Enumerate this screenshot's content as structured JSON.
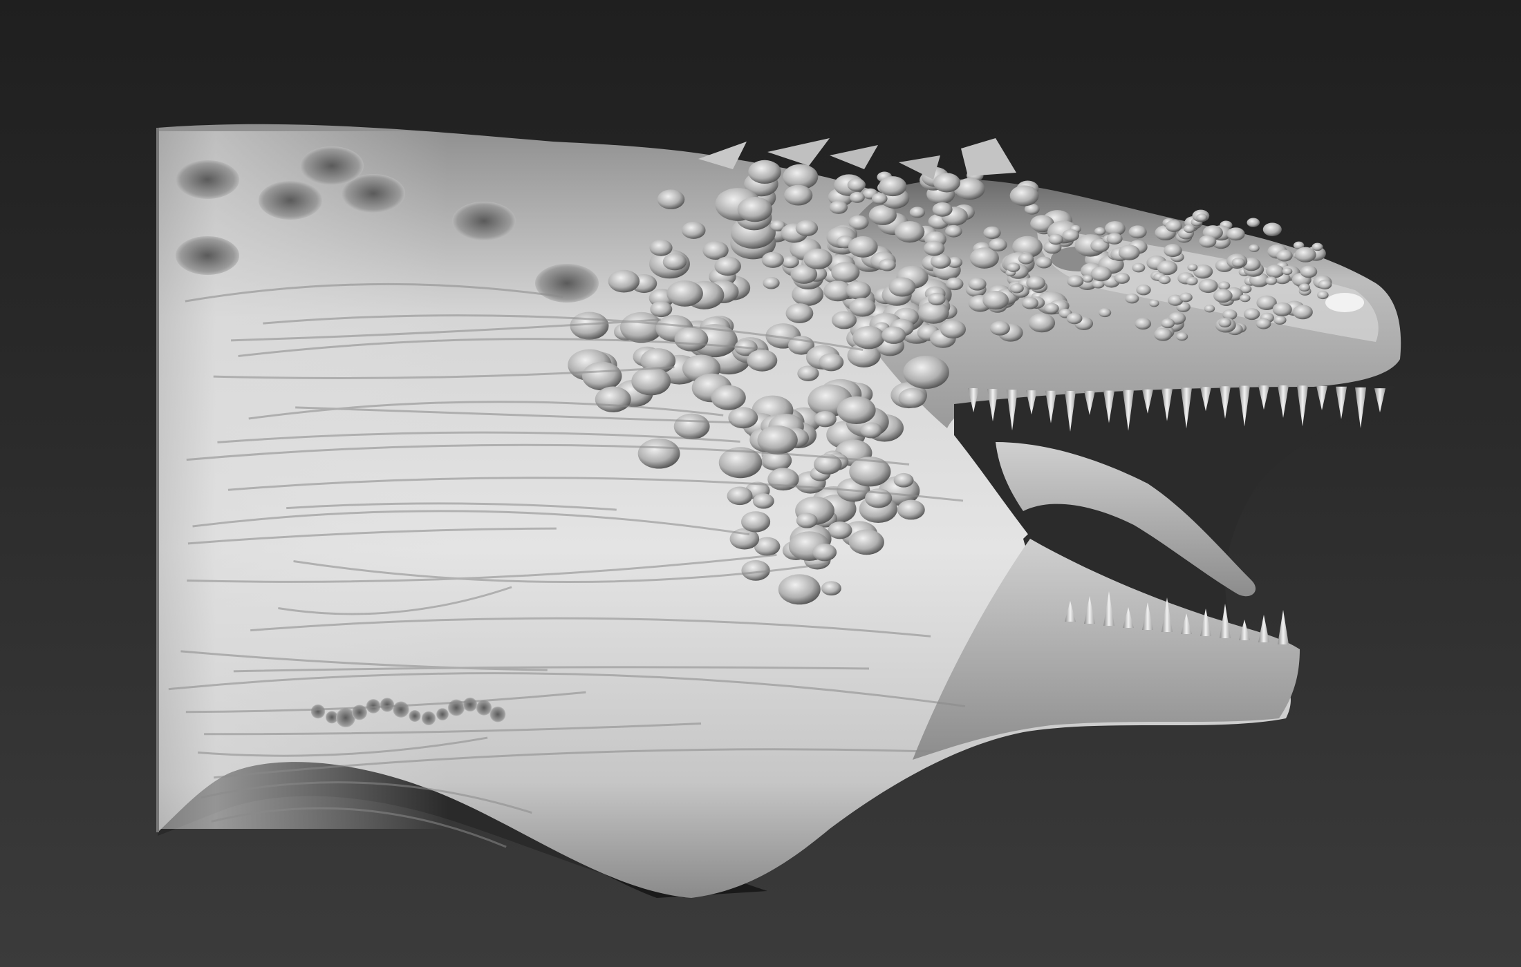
{
  "scene": {
    "background_top": "#1f1f1f",
    "background_bottom": "#3b3b3b",
    "subject": "sculpted-creature-head",
    "material_light": "#e6e6e6",
    "material_mid": "#a8a8a8",
    "material_dark": "#3a3a3a",
    "cast_shadow": "#111111"
  }
}
